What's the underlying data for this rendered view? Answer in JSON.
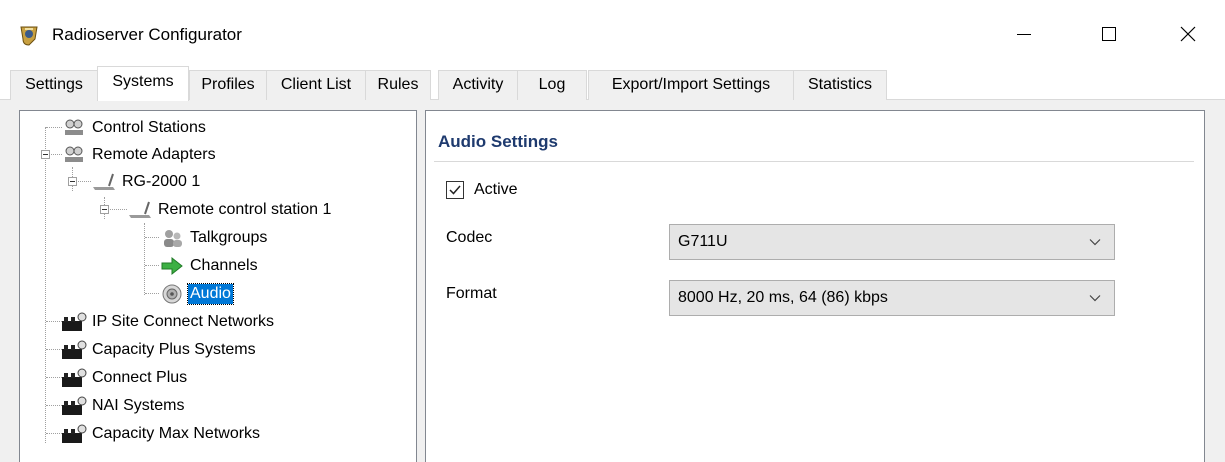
{
  "window": {
    "title": "Radioserver Configurator",
    "app_icon": "radioserver-app-icon",
    "controls": [
      "minimize-icon",
      "maximize-icon",
      "close-icon"
    ]
  },
  "tabs": [
    {
      "label": "Settings",
      "active": false
    },
    {
      "label": "Systems",
      "active": true
    },
    {
      "label": "Profiles",
      "active": false
    },
    {
      "label": "Client List",
      "active": false
    },
    {
      "label": "Rules",
      "active": false
    },
    {
      "label": "Activity",
      "active": false
    },
    {
      "label": "Log",
      "active": false
    },
    {
      "label": "Export/Import Settings",
      "active": false
    },
    {
      "label": "Statistics",
      "active": false
    }
  ],
  "tree": [
    {
      "label": "Control Stations",
      "icon": "control-stations-icon",
      "level": 0
    },
    {
      "label": "Remote Adapters",
      "icon": "remote-adapters-icon",
      "level": 0,
      "expanded": true
    },
    {
      "label": "RG-2000 1",
      "icon": "repeater-gateway-icon",
      "level": 1,
      "expanded": true
    },
    {
      "label": "Remote control station 1",
      "icon": "remote-station-icon",
      "level": 2,
      "expanded": true
    },
    {
      "label": "Talkgroups",
      "icon": "talkgroups-icon",
      "level": 3
    },
    {
      "label": "Channels",
      "icon": "channels-icon",
      "level": 3
    },
    {
      "label": "Audio",
      "icon": "audio-icon",
      "level": 3,
      "selected": true
    },
    {
      "label": "IP Site Connect Networks",
      "icon": "network-icon",
      "level": 0
    },
    {
      "label": "Capacity Plus Systems",
      "icon": "network-icon",
      "level": 0
    },
    {
      "label": "Connect Plus",
      "icon": "network-icon",
      "level": 0
    },
    {
      "label": "NAI Systems",
      "icon": "network-icon",
      "level": 0
    },
    {
      "label": "Capacity Max Networks",
      "icon": "network-icon",
      "level": 0
    }
  ],
  "settings": {
    "header": "Audio Settings",
    "active_label": "Active",
    "active_checked": true,
    "codec_label": "Codec",
    "codec_value": "G711U",
    "format_label": "Format",
    "format_value": "8000 Hz, 20 ms, 64 (86) kbps"
  },
  "colors": {
    "selection": "#0078d7",
    "header_text": "#1e3a6e",
    "panel_border": "#828790"
  }
}
